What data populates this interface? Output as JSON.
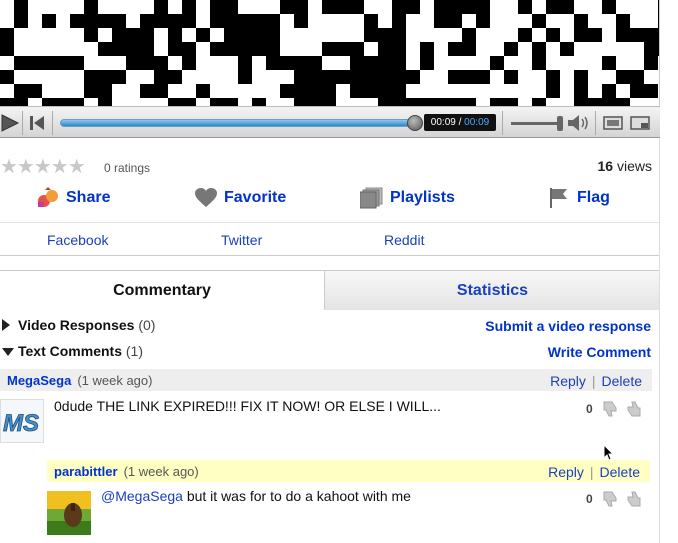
{
  "player": {
    "time_current": "00:09",
    "time_separator": " / ",
    "time_duration": "00:09",
    "progress": 1.0,
    "volume": 0.95
  },
  "rating": {
    "stars_label": "★★★★★",
    "ratings_text": "0 ratings",
    "views_count": "16",
    "views_label": " views"
  },
  "actions": {
    "share": "Share",
    "favorite": "Favorite",
    "playlists": "Playlists",
    "flag": "Flag"
  },
  "share_targets": [
    "Facebook",
    "Twitter",
    "Reddit"
  ],
  "tabs": {
    "commentary": "Commentary",
    "statistics": "Statistics"
  },
  "sections": {
    "video_responses": {
      "label": "Video Responses",
      "count": " (0)",
      "action": "Submit a video response"
    },
    "text_comments": {
      "label": "Text Comments",
      "count": " (1)",
      "action": "Write Comment"
    }
  },
  "comments": [
    {
      "user": "MegaSega",
      "ago": "(1 week ago)",
      "reply": "Reply",
      "delete": "Delete",
      "text": "0dude THE LINK EXPIRED!!! FIX IT NOW! OR ELSE I WILL...",
      "score": "0",
      "avatar_text": "MS"
    },
    {
      "user": "parabittler",
      "ago": "(1 week ago)",
      "reply": "Reply",
      "delete": "Delete",
      "mention": "@MegaSega",
      "text": " but it was for to do a kahoot with me",
      "score": "0"
    }
  ],
  "colors": {
    "link": "#0033cc",
    "reply_highlight": "#ffffc4",
    "comment_head_bg": "#eeeeee",
    "progress": "#2c87c8"
  }
}
